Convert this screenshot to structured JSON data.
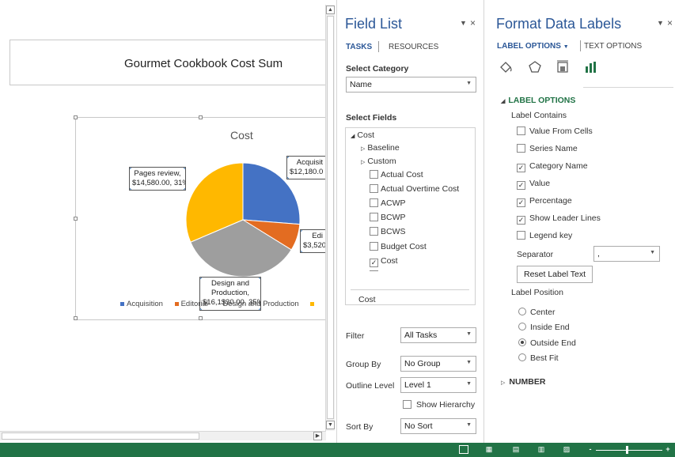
{
  "document": {
    "title": "Gourmet Cookbook Cost Sum"
  },
  "chart_data": {
    "type": "pie",
    "title": "Cost",
    "categories": [
      "Acquisition",
      "Editorial",
      "Design and Production",
      "Pages review"
    ],
    "values": [
      12180.0,
      3520,
      16130,
      14580.0
    ],
    "percent": [
      26,
      8,
      35,
      31
    ],
    "colors": [
      "#4472c4",
      "#e36c21",
      "#9e9e9e",
      "#ffb800"
    ],
    "labels": {
      "acquisition": "Acquisit\n$12,180.0",
      "editorial": "Edi\n$3,520",
      "design": "Design and\nProduction,\n$16,1$30.00, 35%",
      "pages": "Pages review,\n$14,580.00, 31%"
    },
    "legend": [
      "Acquisition",
      "Editorial",
      "Design and Production",
      ""
    ],
    "legend_text": "Editorial   Design and Production"
  },
  "field_list": {
    "title": "Field List",
    "tabs": [
      "TASKS",
      "RESOURCES"
    ],
    "select_category_label": "Select Category",
    "category_value": "Name",
    "select_fields_label": "Select Fields",
    "tree": [
      {
        "label": "Cost",
        "expanded": true
      },
      {
        "label": "Baseline",
        "expanded": false
      },
      {
        "label": "Custom",
        "expanded": false
      }
    ],
    "fields": [
      {
        "label": "Actual Cost",
        "checked": false
      },
      {
        "label": "Actual Overtime Cost",
        "checked": false
      },
      {
        "label": "ACWP",
        "checked": false
      },
      {
        "label": "BCWP",
        "checked": false
      },
      {
        "label": "BCWS",
        "checked": false
      },
      {
        "label": "Budget Cost",
        "checked": false
      },
      {
        "label": "Cost",
        "checked": true
      }
    ],
    "selected_field": "Cost",
    "filter_label": "Filter",
    "filter_value": "All Tasks",
    "groupby_label": "Group By",
    "groupby_value": "No Group",
    "outline_label": "Outline Level",
    "outline_value": "Level 1",
    "show_hierarchy": "Show Hierarchy",
    "sortby_label": "Sort By",
    "sortby_value": "No Sort"
  },
  "format_pane": {
    "title": "Format Data Labels",
    "tab_label_options": "LABEL OPTIONS",
    "tab_text_options": "TEXT OPTIONS",
    "section_label_options": "LABEL OPTIONS",
    "label_contains": "Label Contains",
    "options": [
      {
        "label": "Value From Cells",
        "checked": false
      },
      {
        "label": "Series Name",
        "checked": false
      },
      {
        "label": "Category Name",
        "checked": true
      },
      {
        "label": "Value",
        "checked": true
      },
      {
        "label": "Percentage",
        "checked": true
      },
      {
        "label": "Show Leader Lines",
        "checked": true
      },
      {
        "label": "Legend key",
        "checked": false
      }
    ],
    "separator_label": "Separator",
    "separator_value": ",",
    "reset_button": "Reset Label Text",
    "label_position": "Label Position",
    "positions": [
      {
        "label": "Center",
        "selected": false
      },
      {
        "label": "Inside End",
        "selected": false
      },
      {
        "label": "Outside End",
        "selected": true
      },
      {
        "label": "Best Fit",
        "selected": false
      }
    ],
    "number_section": "NUMBER"
  },
  "statusbar": {
    "zoom_minus": "-",
    "zoom_plus": "+"
  }
}
